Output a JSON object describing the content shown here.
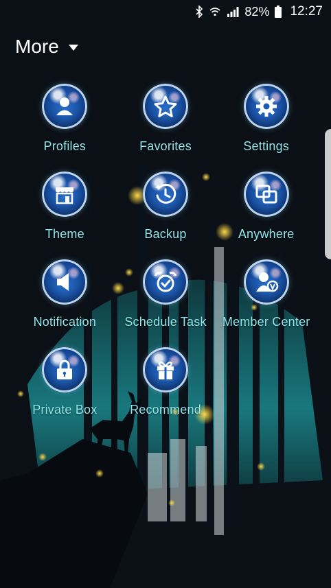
{
  "status_bar": {
    "battery": "82%",
    "time": "12:27",
    "icons": [
      "bluetooth-icon",
      "wifi-icon",
      "signal-icon",
      "battery-icon"
    ]
  },
  "header": {
    "title": "More"
  },
  "menu": {
    "items": [
      {
        "label": "Profiles",
        "icon": "profile-icon"
      },
      {
        "label": "Favorites",
        "icon": "star-icon"
      },
      {
        "label": "Settings",
        "icon": "gear-icon"
      },
      {
        "label": "Theme",
        "icon": "store-icon"
      },
      {
        "label": "Backup",
        "icon": "backup-clock-icon"
      },
      {
        "label": "Anywhere",
        "icon": "windows-icon"
      },
      {
        "label": "Notification",
        "icon": "speaker-icon"
      },
      {
        "label": "Schedule Task",
        "icon": "alarm-icon"
      },
      {
        "label": "Member Center",
        "icon": "member-icon"
      },
      {
        "label": "Private Box",
        "icon": "lock-icon"
      },
      {
        "label": "Recommend",
        "icon": "gift-icon"
      }
    ]
  },
  "colors": {
    "label": "#8fe6ea",
    "background": "#0b1016",
    "teal": "#1f8f93"
  }
}
